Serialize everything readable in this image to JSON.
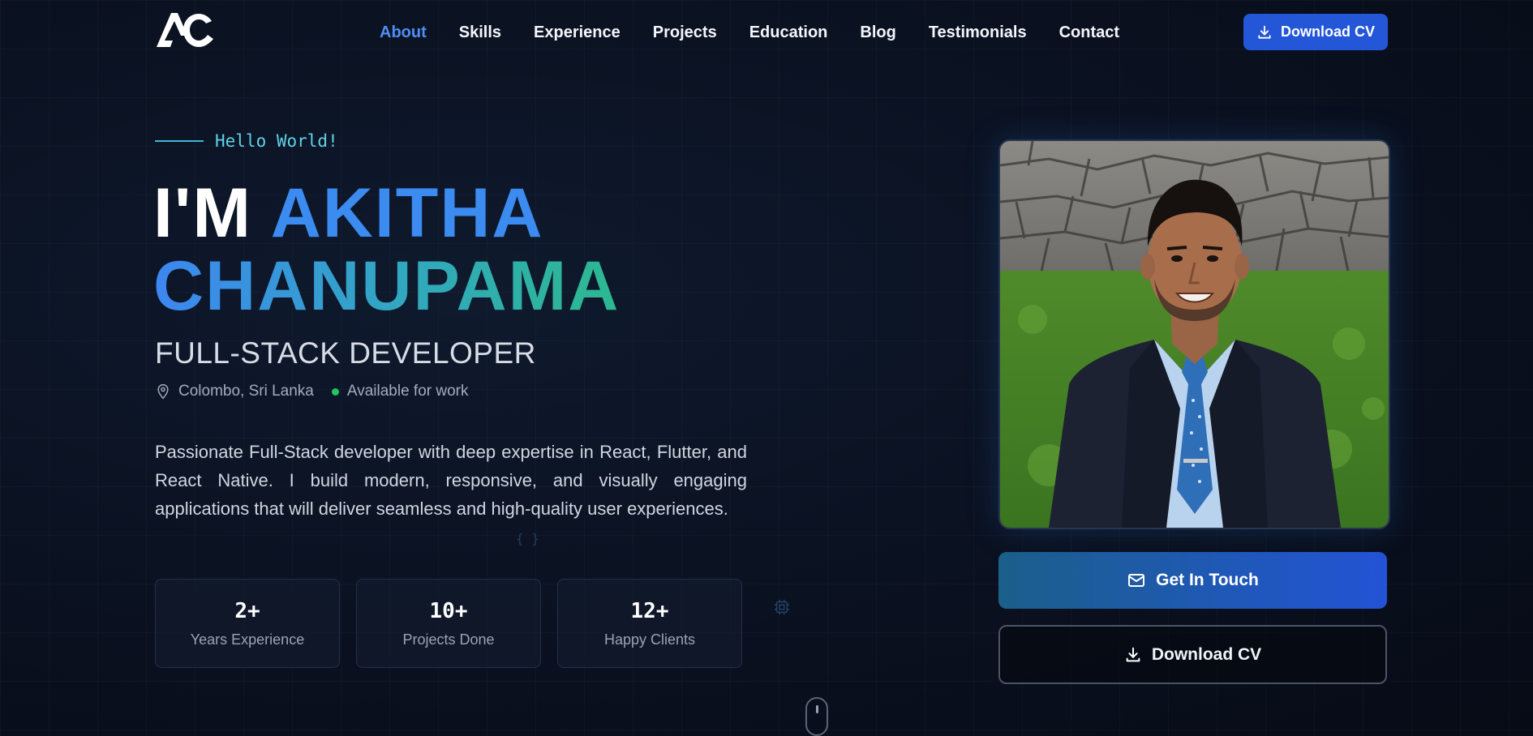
{
  "brand": {
    "logo_text": "AC"
  },
  "nav": {
    "items": [
      {
        "label": "About",
        "active": true
      },
      {
        "label": "Skills"
      },
      {
        "label": "Experience"
      },
      {
        "label": "Projects"
      },
      {
        "label": "Education"
      },
      {
        "label": "Blog"
      },
      {
        "label": "Testimonials"
      },
      {
        "label": "Contact"
      }
    ],
    "download_cv": {
      "label": "Download CV",
      "icon": "download-icon"
    }
  },
  "hero": {
    "greeting": "Hello World!",
    "prefix": "I'M",
    "first_name": "AKITHA",
    "last_name": "CHANUPAMA",
    "role": "FULL-STACK DEVELOPER",
    "location": "Colombo, Sri Lanka",
    "availability": "Available for work",
    "bio": "Passionate Full-Stack developer with deep expertise in React, Flutter, and React Native. I build modern, responsive, and visually engaging applications that will deliver seamless and high-quality user experiences.",
    "stats": [
      {
        "value": "2+",
        "label": "Years Experience"
      },
      {
        "value": "10+",
        "label": "Projects Done"
      },
      {
        "value": "12+",
        "label": "Happy Clients"
      }
    ],
    "decor_brackets": "{ }"
  },
  "actions": {
    "get_in_touch": {
      "label": "Get In Touch",
      "icon": "mail-icon"
    },
    "download_cv": {
      "label": "Download CV",
      "icon": "download-icon"
    }
  },
  "colors": {
    "accent": "#3b8bf0",
    "accent_teal": "#2cb98f",
    "primary_button": "#2456d8",
    "available_dot": "#22c55e"
  }
}
